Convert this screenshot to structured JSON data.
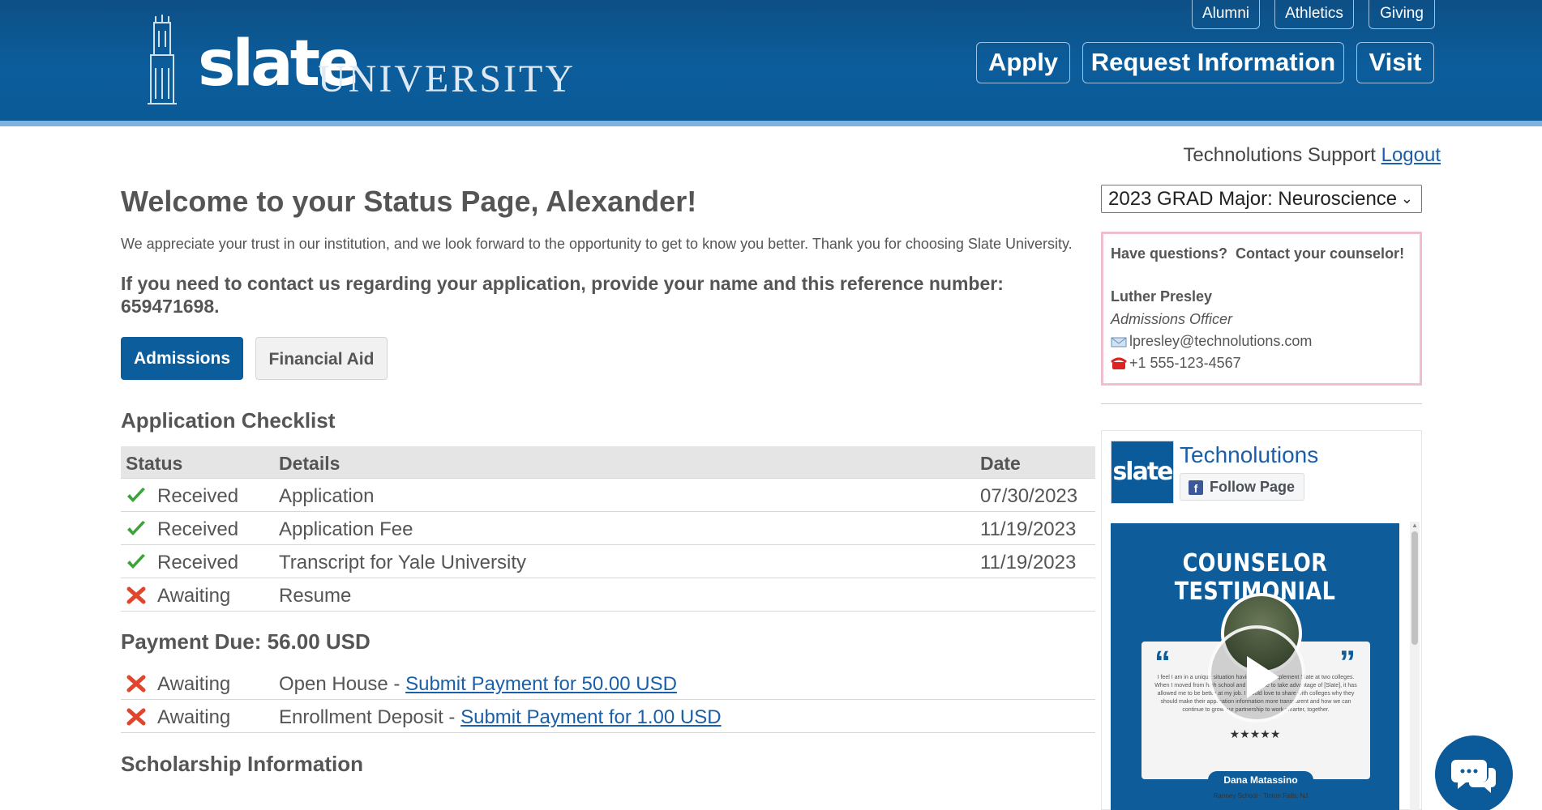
{
  "header": {
    "logo_wordmark": "slate",
    "logo_university": "UNIVERSITY",
    "top_links": [
      "Alumni",
      "Athletics",
      "Giving"
    ],
    "nav_buttons": [
      "Apply",
      "Request Information",
      "Visit"
    ]
  },
  "account": {
    "user": "Technolutions Support",
    "logout": "Logout"
  },
  "main": {
    "title": "Welcome to your Status Page, Alexander!",
    "intro": "We appreciate your trust in our institution, and we look forward to the opportunity to get to know you better. Thank you for choosing Slate University.",
    "reference_text": "If you need to contact us regarding your application, provide your name and this reference number: 659471698.",
    "tabs": [
      "Admissions",
      "Financial Aid"
    ],
    "checklist": {
      "title": "Application Checklist",
      "headers": [
        "Status",
        "Details",
        "Date"
      ],
      "rows": [
        {
          "status": "Received",
          "icon": "check-icon",
          "details": "Application",
          "date": "07/30/2023"
        },
        {
          "status": "Received",
          "icon": "check-icon",
          "details": "Application Fee",
          "date": "11/19/2023"
        },
        {
          "status": "Received",
          "icon": "check-icon",
          "details": "Transcript for Yale University",
          "date": "11/19/2023"
        },
        {
          "status": "Awaiting",
          "icon": "x-icon",
          "details": "Resume",
          "date": ""
        }
      ]
    },
    "payment": {
      "title": "Payment Due: 56.00 USD",
      "rows": [
        {
          "status": "Awaiting",
          "icon": "x-icon",
          "details": "Open House - ",
          "link": "Submit Payment for 50.00 USD"
        },
        {
          "status": "Awaiting",
          "icon": "x-icon",
          "details": "Enrollment Deposit - ",
          "link": "Submit Payment for 1.00 USD"
        }
      ]
    },
    "scholarship_title": "Scholarship Information"
  },
  "sidebar": {
    "program_select": "2023 GRAD Major: Neuroscience",
    "counselor": {
      "heading": "Have questions?  Contact your counselor!",
      "name": "Luther Presley",
      "role": "Admissions Officer",
      "email": "lpresley@technolutions.com",
      "phone": "+1 555-123-4567"
    },
    "facebook": {
      "page_name": "Technolutions",
      "logo_text": "slate",
      "follow_label": "Follow Page",
      "media": {
        "title": "COUNSELOR TESTIMONIAL",
        "quote": "I feel I am in a unique situation having helped implement Slate at two colleges. When I moved from high school and was able to take advantage of [Slate], it has allowed me to be better at my job. I would love to share with colleges why they should make their application information more transparent and how we can continue to grow our partnership to work smarter, together.",
        "stars": "★★★★★",
        "person": "Dana Matassino",
        "school": "Ranney School · Tinton Falls, NJ"
      }
    }
  },
  "colors": {
    "brand_blue": "#0c5d9c",
    "link_blue": "#1a5fa8",
    "counselor_border": "#f0bfcc"
  }
}
